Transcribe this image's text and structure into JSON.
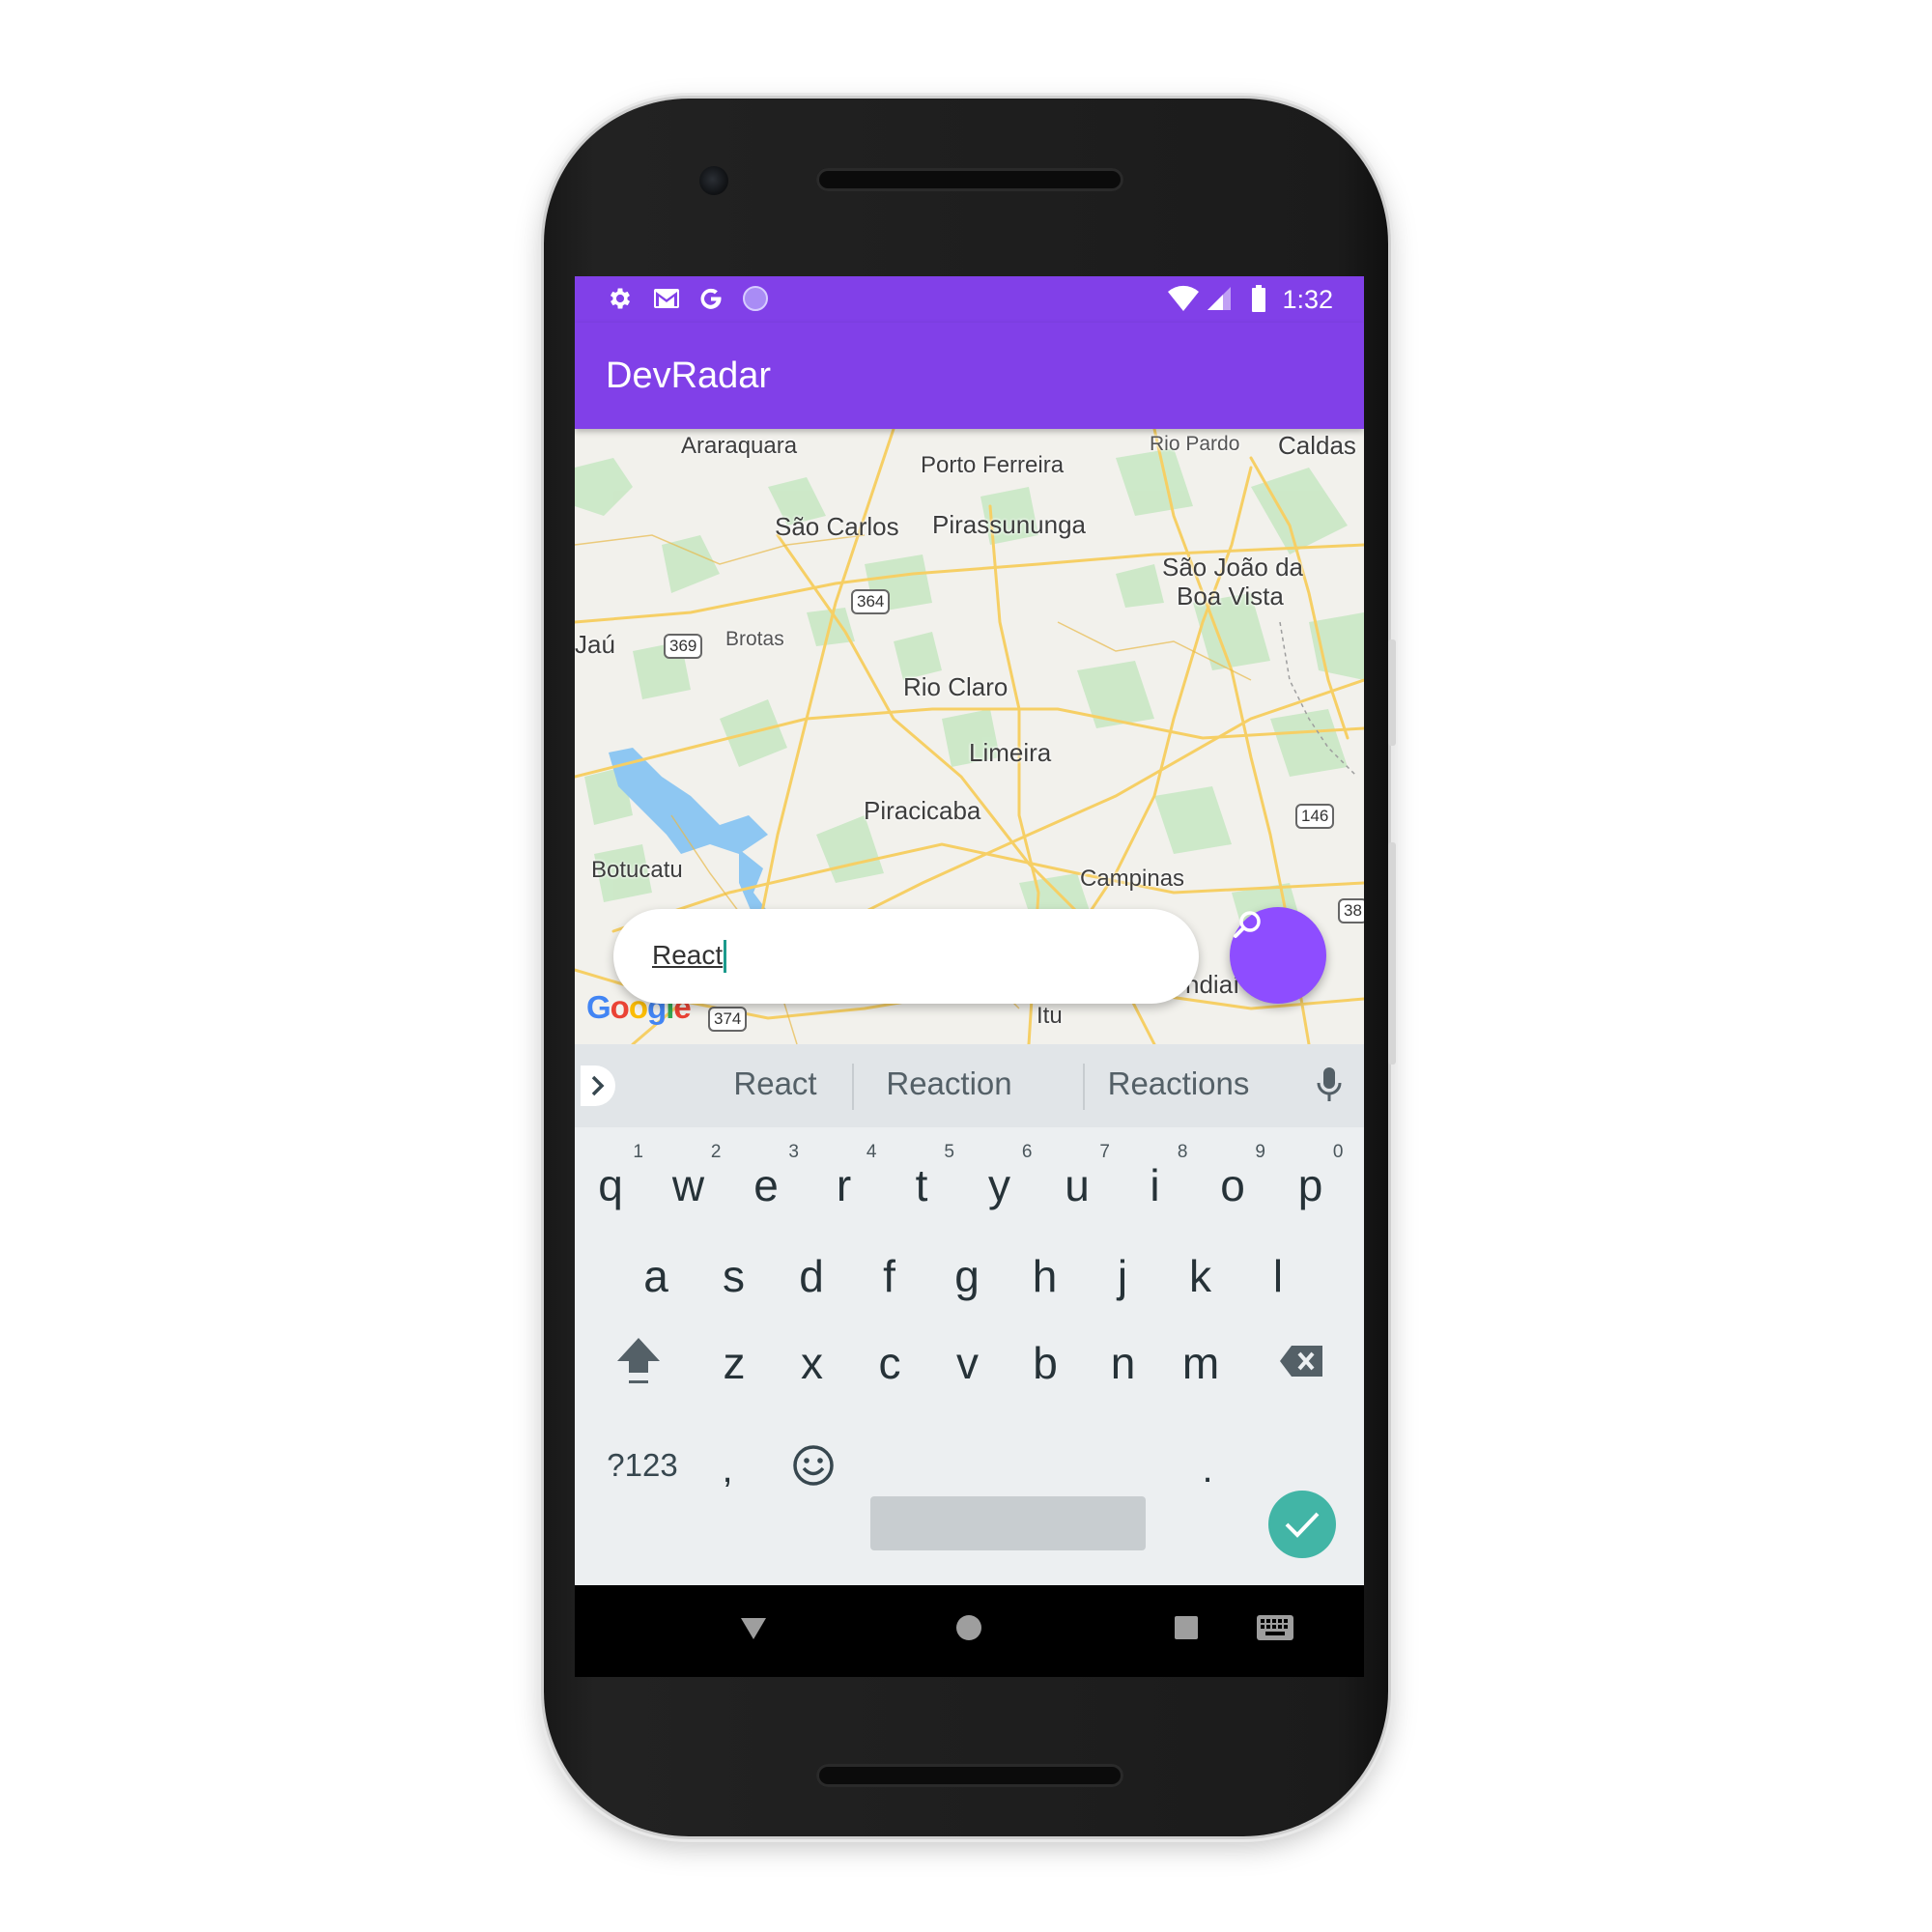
{
  "status_bar": {
    "time": "1:32",
    "left_icons": [
      "gear-icon",
      "gmail-icon",
      "google-g-icon",
      "circle-app-icon"
    ],
    "right_icons": [
      "wifi-icon",
      "signal-icon",
      "battery-icon"
    ]
  },
  "app_bar": {
    "title": "DevRadar"
  },
  "map": {
    "cities": [
      "Araraquara",
      "Porto Ferreira",
      "Rio Pardo",
      "Caldas",
      "São Carlos",
      "Pirassununga",
      "São João da",
      "Boa Vista",
      "Jaú",
      "Brotas",
      "Rio Claro",
      "Limeira",
      "Piracicaba",
      "Botucatu",
      "Campinas",
      "Itu",
      "ndiaí"
    ],
    "road_shields": [
      "364",
      "369",
      "146",
      "38",
      "374"
    ],
    "attribution": "Google",
    "colors": {
      "land": "#f2f1ec",
      "green": "#c9e8c5",
      "roads": "#f6cf65",
      "water": "#8ec7f2"
    }
  },
  "search": {
    "value": "React",
    "button_icon": "search-icon",
    "accent": "#8e4dff"
  },
  "keyboard": {
    "suggestions": [
      "React",
      "Reaction",
      "Reactions"
    ],
    "row1": [
      {
        "k": "q",
        "n": "1"
      },
      {
        "k": "w",
        "n": "2"
      },
      {
        "k": "e",
        "n": "3"
      },
      {
        "k": "r",
        "n": "4"
      },
      {
        "k": "t",
        "n": "5"
      },
      {
        "k": "y",
        "n": "6"
      },
      {
        "k": "u",
        "n": "7"
      },
      {
        "k": "i",
        "n": "8"
      },
      {
        "k": "o",
        "n": "9"
      },
      {
        "k": "p",
        "n": "0"
      }
    ],
    "row2": [
      "a",
      "s",
      "d",
      "f",
      "g",
      "h",
      "j",
      "k",
      "l"
    ],
    "row3": [
      "z",
      "x",
      "c",
      "v",
      "b",
      "n",
      "m"
    ],
    "symbols_label": "?123",
    "comma": ",",
    "period": ".",
    "enter_color": "#42b5a6"
  },
  "nav_bar": {
    "icons": [
      "back-icon",
      "home-icon",
      "recents-icon",
      "keyboard-switch-icon"
    ]
  },
  "theme": {
    "primary": "#8140e8"
  }
}
